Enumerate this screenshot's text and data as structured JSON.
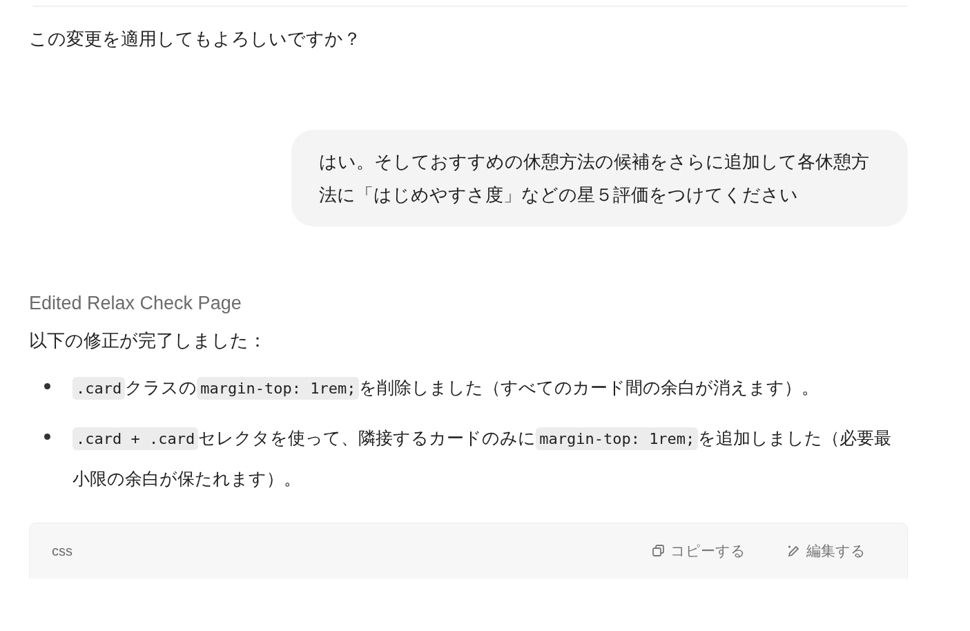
{
  "assistant_question": "この変更を適用してもよろしいですか？",
  "user_message": "はい。そしておすすめの休憩方法の候補をさらに追加して各休憩方法に「はじめやすさ度」などの星５評価をつけてください",
  "edit_label": "Edited Relax Check Page",
  "summary": "以下の修正が完了しました：",
  "bullets": [
    [
      {
        "kind": "code",
        "text": ".card"
      },
      {
        "kind": "text",
        "text": "クラスの"
      },
      {
        "kind": "code",
        "text": "margin-top: 1rem;"
      },
      {
        "kind": "text",
        "text": "を削除しました（すべてのカード間の余白が消えます）。"
      }
    ],
    [
      {
        "kind": "code",
        "text": ".card + .card"
      },
      {
        "kind": "text",
        "text": "セレクタを使って、隣接するカードのみに"
      },
      {
        "kind": "code",
        "text": "margin-top: 1rem;"
      },
      {
        "kind": "text",
        "text": "を追加しました（必要最小限の余白が保たれます）。"
      }
    ]
  ],
  "code_block": {
    "language": "css",
    "copy_label": "コピーする",
    "edit_label": "編集する"
  }
}
